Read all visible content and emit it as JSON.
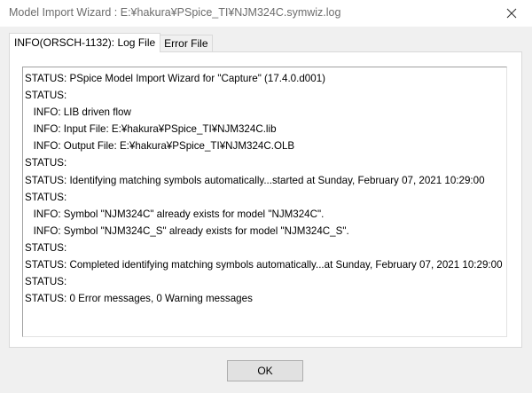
{
  "window": {
    "title": "Model Import Wizard : E:¥hakura¥PSpice_TI¥NJM324C.symwiz.log"
  },
  "tabs": [
    {
      "label": "INFO(ORSCH-1132): Log File",
      "active": true
    },
    {
      "label": "Error File",
      "active": false
    }
  ],
  "log": {
    "lines": [
      "STATUS: PSpice Model Import Wizard for \"Capture\" (17.4.0.d001)",
      "STATUS:",
      "   INFO: LIB driven flow",
      "   INFO: Input File: E:¥hakura¥PSpice_TI¥NJM324C.lib",
      "   INFO: Output File: E:¥hakura¥PSpice_TI¥NJM324C.OLB",
      "STATUS:",
      "STATUS: Identifying matching symbols automatically...started at Sunday, February 07, 2021 10:29:00",
      "STATUS:",
      "   INFO: Symbol \"NJM324C\" already exists for model \"NJM324C\".",
      "   INFO: Symbol \"NJM324C_S\" already exists for model \"NJM324C_S\".",
      "STATUS:",
      "STATUS: Completed identifying matching symbols automatically...at Sunday, February 07, 2021 10:29:00",
      "STATUS:",
      "STATUS: 0 Error messages, 0 Warning messages"
    ]
  },
  "buttons": {
    "ok_label": "OK"
  },
  "icons": {
    "close": "close-icon"
  }
}
